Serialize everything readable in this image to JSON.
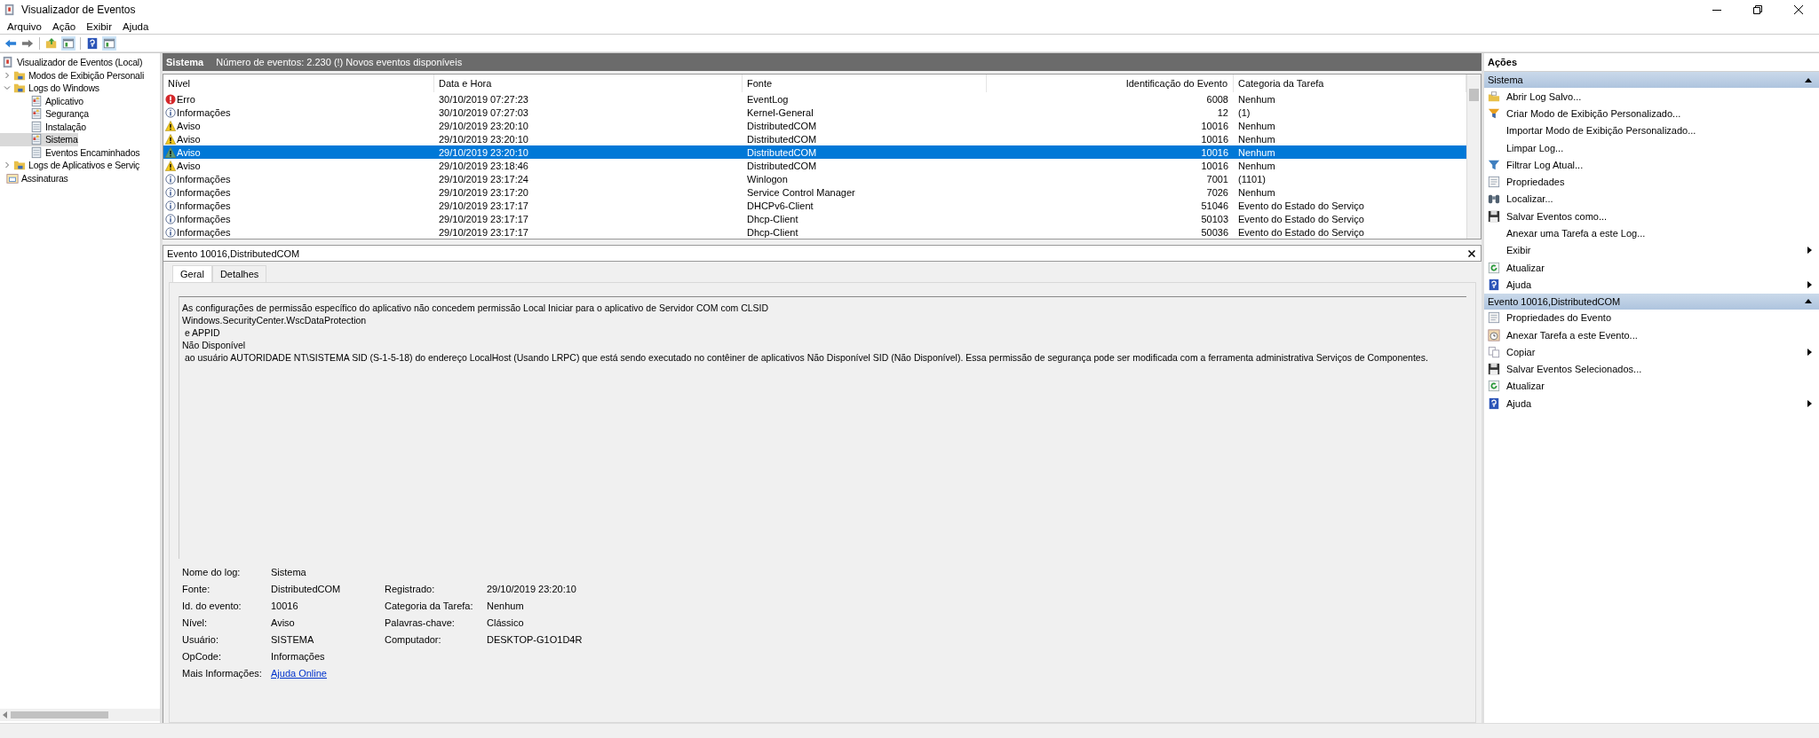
{
  "window": {
    "title": "Visualizador de Eventos"
  },
  "menu": [
    "Arquivo",
    "Ação",
    "Exibir",
    "Ajuda"
  ],
  "toolbar": [
    {
      "kind": "back",
      "pressed": false
    },
    {
      "kind": "forward",
      "pressed": false
    },
    {
      "kind": "up",
      "pressed": false
    },
    {
      "kind": "pane",
      "pressed": true
    },
    {
      "kind": "help",
      "pressed": false
    },
    {
      "kind": "pane",
      "pressed": true
    }
  ],
  "tree": [
    {
      "label": "Visualizador de Eventos (Local)",
      "selected": false,
      "children": [
        {
          "label": "Modos de Exibição Personali",
          "kind": "folder",
          "selected": false,
          "expanded": false
        },
        {
          "label": "Logs do Windows",
          "kind": "folder",
          "selected": false,
          "expanded": true,
          "children": [
            {
              "label": "Aplicativo",
              "kind": "log",
              "selected": false
            },
            {
              "label": "Segurança",
              "kind": "log",
              "selected": false
            },
            {
              "label": "Instalação",
              "kind": "plainlog",
              "selected": false
            },
            {
              "label": "Sistema",
              "kind": "log",
              "selected": true
            },
            {
              "label": "Eventos Encaminhados",
              "kind": "plainlog",
              "selected": false
            }
          ]
        },
        {
          "label": "Logs de Aplicativos e Serviç",
          "kind": "folder",
          "selected": false,
          "expanded": false
        },
        {
          "label": "Assinaturas",
          "kind": "subs",
          "selected": false
        }
      ]
    }
  ],
  "log_header": {
    "name": "Sistema",
    "info": "Número de eventos: 2.230 (!) Novos eventos disponíveis"
  },
  "table": {
    "columns": [
      "Nível",
      "Data e Hora",
      "Fonte",
      "Identificação do Evento",
      "Categoria da Tarefa"
    ],
    "rows": [
      {
        "kind": "error",
        "level": "Erro",
        "date": "30/10/2019 07:27:23",
        "source": "EventLog",
        "id": "6008",
        "category": "Nenhum",
        "selected": false
      },
      {
        "kind": "info",
        "level": "Informações",
        "date": "30/10/2019 07:27:03",
        "source": "Kernel-General",
        "id": "12",
        "category": "(1)",
        "selected": false
      },
      {
        "kind": "warning",
        "level": "Aviso",
        "date": "29/10/2019 23:20:10",
        "source": "DistributedCOM",
        "id": "10016",
        "category": "Nenhum",
        "selected": false
      },
      {
        "kind": "warning",
        "level": "Aviso",
        "date": "29/10/2019 23:20:10",
        "source": "DistributedCOM",
        "id": "10016",
        "category": "Nenhum",
        "selected": false
      },
      {
        "kind": "warning",
        "level": "Aviso",
        "date": "29/10/2019 23:20:10",
        "source": "DistributedCOM",
        "id": "10016",
        "category": "Nenhum",
        "selected": true
      },
      {
        "kind": "warning",
        "level": "Aviso",
        "date": "29/10/2019 23:18:46",
        "source": "DistributedCOM",
        "id": "10016",
        "category": "Nenhum",
        "selected": false
      },
      {
        "kind": "info",
        "level": "Informações",
        "date": "29/10/2019 23:17:24",
        "source": "Winlogon",
        "id": "7001",
        "category": "(1101)",
        "selected": false
      },
      {
        "kind": "info",
        "level": "Informações",
        "date": "29/10/2019 23:17:20",
        "source": "Service Control Manager",
        "id": "7026",
        "category": "Nenhum",
        "selected": false
      },
      {
        "kind": "info",
        "level": "Informações",
        "date": "29/10/2019 23:17:17",
        "source": "DHCPv6-Client",
        "id": "51046",
        "category": "Evento do Estado do Serviço",
        "selected": false
      },
      {
        "kind": "info",
        "level": "Informações",
        "date": "29/10/2019 23:17:17",
        "source": "Dhcp-Client",
        "id": "50103",
        "category": "Evento do Estado do Serviço",
        "selected": false
      },
      {
        "kind": "info",
        "level": "Informações",
        "date": "29/10/2019 23:17:17",
        "source": "Dhcp-Client",
        "id": "50036",
        "category": "Evento do Estado do Serviço",
        "selected": false
      }
    ]
  },
  "detail": {
    "title": "Evento 10016,DistributedCOM",
    "tabs": [
      {
        "label": "Geral",
        "selected": true
      },
      {
        "label": "Detalhes",
        "selected": false
      }
    ],
    "message": [
      "As configurações de permissão específico do aplicativo não concedem permissão Local Iniciar para o aplicativo de Servidor COM com CLSID",
      "Windows.SecurityCenter.WscDataProtection",
      " e APPID",
      "Não Disponível",
      " ao usuário AUTORIDADE NT\\SISTEMA SID (S-1-5-18) do endereço LocalHost (Usando LRPC) que está sendo executado no contêiner de aplicativos Não Disponível SID (Não Disponível). Essa permissão de segurança pode ser modificada com a ferramenta administrativa Serviços de Componentes."
    ],
    "properties": [
      {
        "label": "Nome do log:",
        "value": "Sistema"
      },
      {
        "label": "Fonte:",
        "value": "DistributedCOM",
        "right": {
          "label": "Registrado:",
          "value": "29/10/2019 23:20:10"
        }
      },
      {
        "label": "Id. do evento:",
        "value": "10016",
        "right": {
          "label": "Categoria da Tarefa:",
          "value": "Nenhum"
        }
      },
      {
        "label": "Nível:",
        "value": "Aviso",
        "right": {
          "label": "Palavras-chave:",
          "value": "Clássico"
        }
      },
      {
        "label": "Usuário:",
        "value": "SISTEMA",
        "right": {
          "label": "Computador:",
          "value": "DESKTOP-G1O1D4R"
        }
      },
      {
        "label": "OpCode:",
        "value": "Informações"
      },
      {
        "label": "Mais Informações:",
        "value": "Ajuda Online",
        "kind": "link"
      }
    ]
  },
  "actions": {
    "title": "Ações",
    "sections": [
      {
        "title": "Sistema",
        "items": [
          {
            "label": "Abrir Log Salvo...",
            "kind": "open",
            "submenu": false
          },
          {
            "label": "Criar Modo de Exibição Personalizado...",
            "kind": "filter",
            "submenu": false
          },
          {
            "label": "Importar Modo de Exibição Personalizado...",
            "kind": "plain",
            "submenu": false
          },
          {
            "label": "Limpar Log...",
            "kind": "plain",
            "submenu": false
          },
          {
            "label": "Filtrar Log Atual...",
            "kind": "funnel",
            "submenu": false
          },
          {
            "label": "Propriedades",
            "kind": "properties",
            "submenu": false
          },
          {
            "label": "Localizar...",
            "kind": "find",
            "submenu": false
          },
          {
            "label": "Salvar Eventos como...",
            "kind": "save",
            "submenu": false
          },
          {
            "label": "Anexar uma Tarefa a este Log...",
            "kind": "plain",
            "submenu": false
          },
          {
            "label": "Exibir",
            "kind": "plain",
            "submenu": true
          },
          {
            "label": "Atualizar",
            "kind": "refresh",
            "submenu": false
          },
          {
            "label": "Ajuda",
            "kind": "help",
            "submenu": true
          }
        ]
      },
      {
        "title": "Evento 10016,DistributedCOM",
        "items": [
          {
            "label": "Propriedades do Evento",
            "kind": "properties",
            "submenu": false
          },
          {
            "label": "Anexar Tarefa a este Evento...",
            "kind": "task",
            "submenu": false
          },
          {
            "label": "Copiar",
            "kind": "copy",
            "submenu": true
          },
          {
            "label": "Salvar Eventos Selecionados...",
            "kind": "save",
            "submenu": false
          },
          {
            "label": "Atualizar",
            "kind": "refresh",
            "submenu": false
          },
          {
            "label": "Ajuda",
            "kind": "help",
            "submenu": true
          }
        ]
      }
    ]
  }
}
